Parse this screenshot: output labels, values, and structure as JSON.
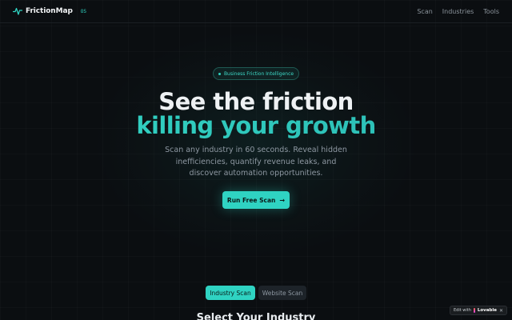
{
  "header": {
    "brand": "FrictionMap",
    "brand_badge": "OS",
    "nav": [
      "Scan",
      "Industries",
      "Tools"
    ]
  },
  "hero": {
    "badge": "Business Friction Intelligence",
    "title_line1": "See the friction",
    "title_line2": "killing your growth",
    "subtitle": "Scan any industry in 60 seconds. Reveal hidden inefficiencies, quantify revenue leaks, and discover automation opportunities.",
    "cta_label": "Run Free Scan",
    "cta_arrow": "→"
  },
  "scan_tabs": [
    {
      "label": "Industry Scan",
      "active": true
    },
    {
      "label": "Website Scan",
      "active": false
    }
  ],
  "section_title": "Select Your Industry",
  "lovable_badge": {
    "prefix": "Edit with",
    "brand": "Lovable",
    "close": "✕"
  },
  "colors": {
    "accent": "#2fd3c2",
    "background": "#0b0e11",
    "muted_text": "#8e98a2"
  },
  "icons": {
    "logo": "pulse-line-icon",
    "badge": "dot-icon",
    "cta": "arrow-right-icon",
    "lovable": "heart-icon",
    "close": "close-icon"
  }
}
